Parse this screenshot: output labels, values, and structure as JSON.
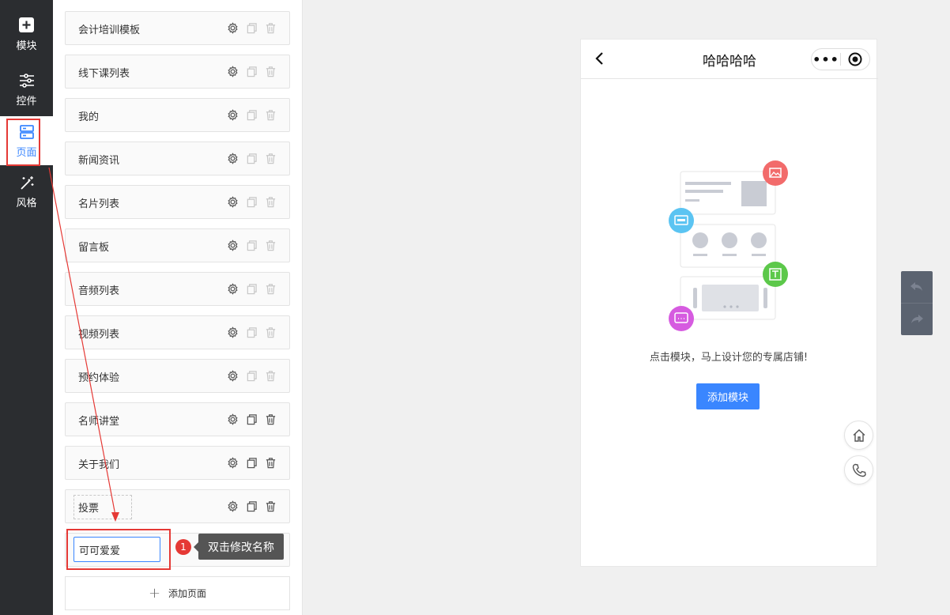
{
  "nav": {
    "items": [
      {
        "label": "模块",
        "icon": "plus-square-icon"
      },
      {
        "label": "控件",
        "icon": "sliders-icon"
      },
      {
        "label": "页面",
        "icon": "pages-icon"
      },
      {
        "label": "风格",
        "icon": "magic-wand-icon"
      }
    ],
    "active": "页面"
  },
  "pages": {
    "items": [
      {
        "name": "会计培训模板"
      },
      {
        "name": "线下课列表"
      },
      {
        "name": "我的"
      },
      {
        "name": "新闻资讯"
      },
      {
        "name": "名片列表"
      },
      {
        "name": "留言板"
      },
      {
        "name": "音频列表"
      },
      {
        "name": "视频列表"
      },
      {
        "name": "预约体验"
      },
      {
        "name": "名师讲堂"
      },
      {
        "name": "关于我们"
      },
      {
        "name": "投票"
      }
    ],
    "renaming_value": "可可爱爱",
    "add_label": "添加页面"
  },
  "tooltip": {
    "step": "1",
    "text": "双击修改名称"
  },
  "phone": {
    "title": "哈哈哈哈",
    "capsule_dots": "•••",
    "empty_text": "点击模块，马上设计您的专属店铺!",
    "add_module_label": "添加模块"
  },
  "colors": {
    "accent": "#3a86ff",
    "highlight": "#e53935",
    "nav_bg": "#2b2d30"
  }
}
